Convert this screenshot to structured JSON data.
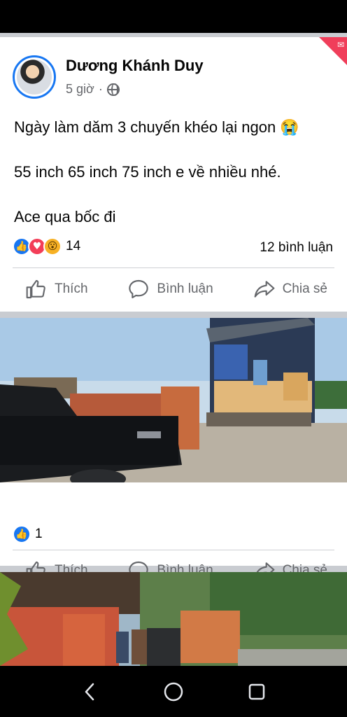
{
  "post": {
    "author": "Dương Khánh Duy",
    "time": "5 giờ",
    "time_separator": "·",
    "lines": [
      "Ngày làm dăm 3 chuyến khéo lại ngon 😭",
      "55 inch 65 inch 75 inch e về nhiều nhé.",
      "Ace qua bốc đi"
    ],
    "reactions": {
      "count": "14",
      "icons": [
        "like-icon",
        "love-icon",
        "wow-icon"
      ]
    },
    "comments": "12 bình luận",
    "actions": {
      "like": "Thích",
      "comment": "Bình luận",
      "share": "Chia sẻ"
    }
  },
  "photo_post_1": {
    "reactions": {
      "count": "1"
    },
    "actions": {
      "like": "Thích",
      "comment": "Bình luận",
      "share": "Chia sẻ"
    }
  },
  "colors": {
    "brand_blue": "#1877f2",
    "love_red": "#f33e58",
    "wow_yellow": "#f7b125",
    "muted": "#65676b",
    "badge": "#f03e5a"
  }
}
